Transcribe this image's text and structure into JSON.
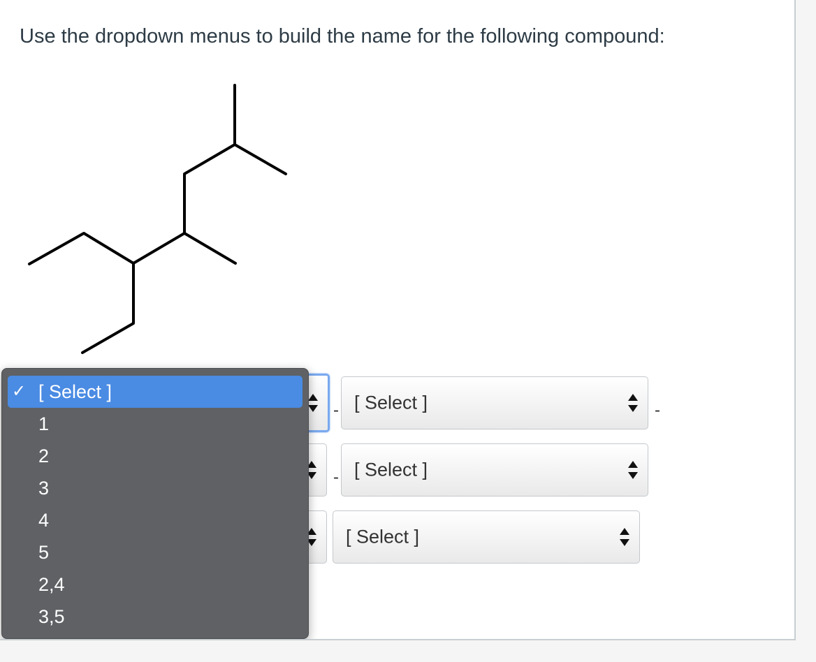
{
  "question": {
    "text": "Use the dropdown menus to build the name for the following compound:"
  },
  "row1": {
    "select2_label": "[ Select ]",
    "dash_a": "-",
    "dash_b": "-"
  },
  "row2": {
    "select2_label": "[ Select ]",
    "dash_a": "-"
  },
  "row3": {
    "select2_label": "[ Select ]"
  },
  "dropdown": {
    "options": [
      "[ Select ]",
      "1",
      "2",
      "3",
      "4",
      "5",
      "2,4",
      "3,5"
    ],
    "selected_index": 0,
    "check_glyph": "✓"
  },
  "colors": {
    "selected_bg": "#4a8be3",
    "menu_bg": "#5f6164",
    "focus_ring": "#7aa9ee"
  }
}
